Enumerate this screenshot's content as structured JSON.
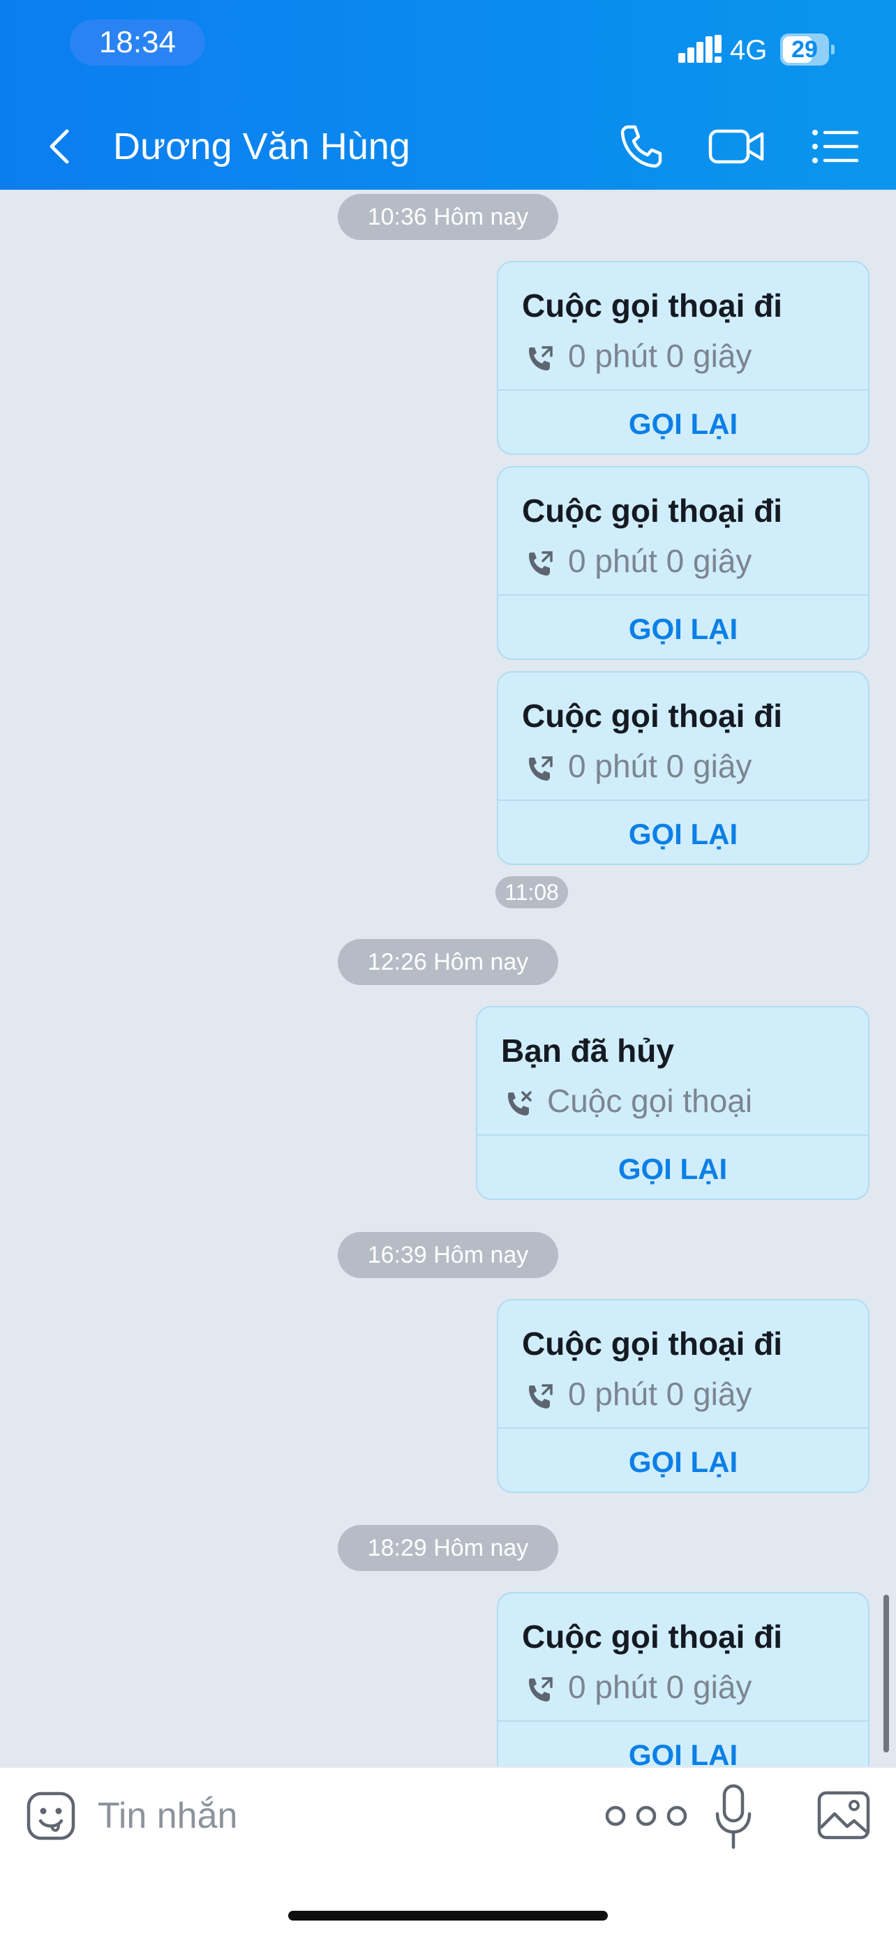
{
  "status_bar": {
    "time": "18:34",
    "network": "4G",
    "battery": "29"
  },
  "header": {
    "contact_name": "Dương Văn Hùng",
    "icons": {
      "back": "chevron-left-icon",
      "call": "phone-icon",
      "video": "video-camera-icon",
      "menu": "list-menu-icon"
    }
  },
  "messages": [
    {
      "kind": "date",
      "text": "10:36 Hôm nay"
    },
    {
      "kind": "call",
      "title": "Cuộc gọi thoại đi",
      "detail": "0 phút 0 giây",
      "action": "GỌI LẠI",
      "icon": "outgoing-call-icon"
    },
    {
      "kind": "call",
      "title": "Cuộc gọi thoại đi",
      "detail": "0 phút 0 giây",
      "action": "GỌI LẠI",
      "icon": "outgoing-call-icon"
    },
    {
      "kind": "call",
      "title": "Cuộc gọi thoại đi",
      "detail": "0 phút 0 giây",
      "action": "GỌI LẠI",
      "icon": "outgoing-call-icon"
    },
    {
      "kind": "time",
      "text": "11:08"
    },
    {
      "kind": "date",
      "text": "12:26 Hôm nay"
    },
    {
      "kind": "call",
      "title": "Bạn đã hủy",
      "detail": "Cuộc gọi thoại",
      "action": "GỌI LẠI",
      "icon": "cancelled-call-icon"
    },
    {
      "kind": "date",
      "text": "16:39 Hôm nay"
    },
    {
      "kind": "call",
      "title": "Cuộc gọi thoại đi",
      "detail": "0 phút 0 giây",
      "action": "GỌI LẠI",
      "icon": "outgoing-call-icon"
    },
    {
      "kind": "date",
      "text": "18:29 Hôm nay"
    },
    {
      "kind": "call",
      "title": "Cuộc gọi thoại đi",
      "detail": "0 phút 0 giây",
      "action": "GỌI LẠI",
      "icon": "outgoing-call-icon"
    }
  ],
  "composer": {
    "placeholder": "Tin nhắn",
    "icons": {
      "emoji": "sticker-emoji-icon",
      "more": "more-dots-icon",
      "mic": "microphone-icon",
      "image": "image-gallery-icon"
    }
  },
  "colors": {
    "header": "#0b86ef",
    "bubble": "#d0edfb",
    "accent": "#0b7fe6",
    "chat_bg": "#e2e8f0"
  }
}
